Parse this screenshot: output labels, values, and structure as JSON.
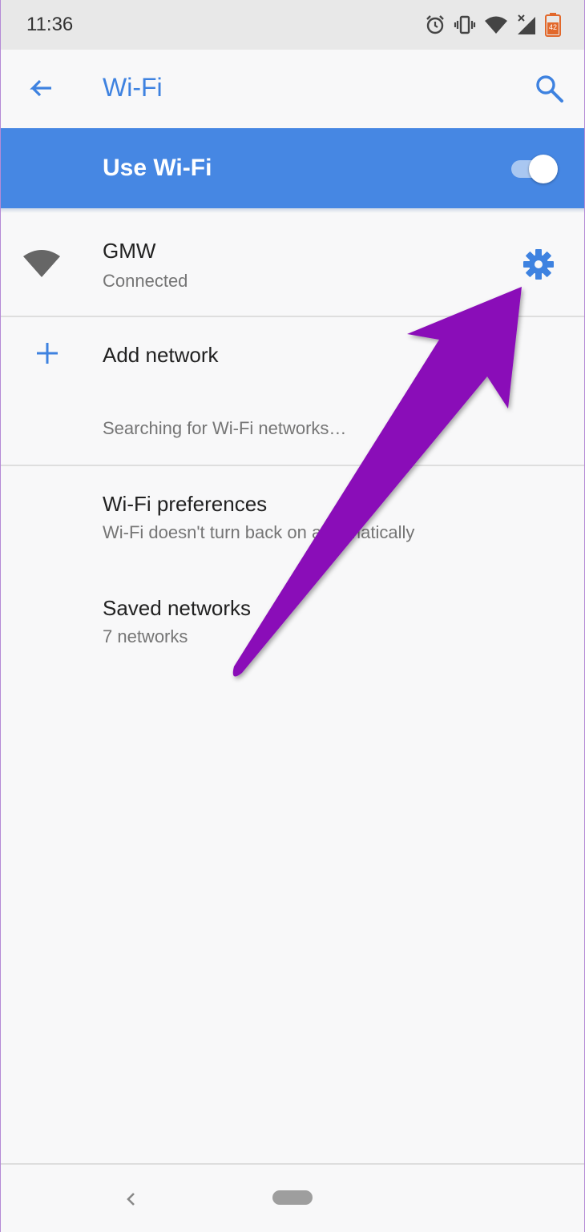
{
  "status_bar": {
    "time": "11:36",
    "icons": [
      "alarm-icon",
      "vibrate-icon",
      "wifi-status-icon",
      "cell-signal-icon",
      "battery-icon"
    ],
    "battery_level": "42"
  },
  "app_bar": {
    "title": "Wi-Fi",
    "back_icon": "arrow-left-icon",
    "search_icon": "search-icon"
  },
  "use_wifi": {
    "label": "Use Wi-Fi",
    "enabled": true
  },
  "connected_network": {
    "name": "GMW",
    "status": "Connected",
    "settings_icon": "gear-icon"
  },
  "add_network": {
    "label": "Add network"
  },
  "searching_text": "Searching for Wi-Fi networks…",
  "preferences": {
    "title": "Wi-Fi preferences",
    "subtitle": "Wi-Fi doesn't turn back on automatically"
  },
  "saved_networks": {
    "title": "Saved networks",
    "subtitle": "7 networks"
  },
  "colors": {
    "accent": "#3e82e0",
    "bar": "#4687e3",
    "annotation_arrow": "#8a10b8"
  }
}
